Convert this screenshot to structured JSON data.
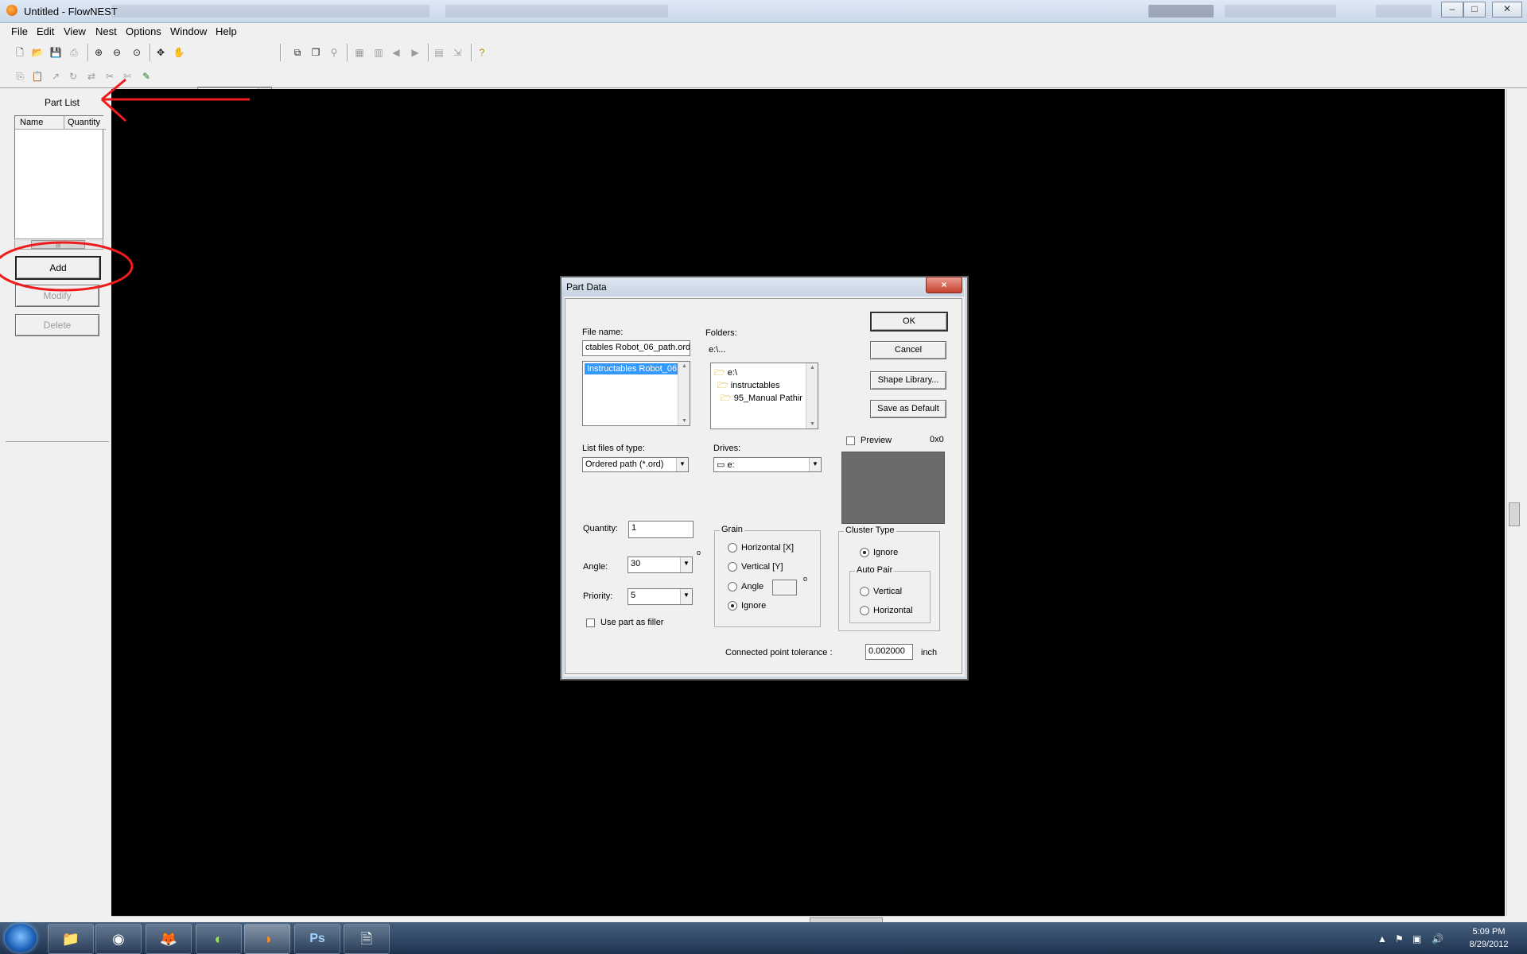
{
  "window": {
    "title": "Untitled - FlowNEST"
  },
  "menubar": [
    "File",
    "Edit",
    "View",
    "Nest",
    "Options",
    "Window",
    "Help"
  ],
  "toolbar": {
    "unit": "inch"
  },
  "part_list": {
    "title": "Part List",
    "columns": [
      "Name",
      "Quantity"
    ],
    "scroll_thumb": "|||",
    "buttons": {
      "add": "Add",
      "modify": "Modify",
      "delete": "Delete"
    }
  },
  "dialog": {
    "title": "Part Data",
    "close": "×",
    "file_name_label": "File name:",
    "file_name_value": "ctables Robot_06_path.ord",
    "file_list_selected": "Instructables Robot_06",
    "folders_label": "Folders:",
    "folders_path": "e:\\...",
    "folders": [
      "e:\\",
      "instructables",
      "95_Manual Pathir"
    ],
    "list_type_label": "List files of type:",
    "list_type_value": "Ordered path (*.ord)",
    "drives_label": "Drives:",
    "drives_value": "e:",
    "preview_label": "Preview",
    "preview_size": "0x0",
    "buttons": {
      "ok": "OK",
      "cancel": "Cancel",
      "shape_library": "Shape Library...",
      "save_default": "Save as Default"
    },
    "quantity_label": "Quantity:",
    "quantity_value": "1",
    "angle_label": "Angle:",
    "angle_value": "30",
    "degree_mark": "o",
    "priority_label": "Priority:",
    "priority_value": "5",
    "use_filler_label": "Use part as filler",
    "grain": {
      "title": "Grain",
      "options": [
        "Horizontal [X]",
        "Vertical [Y]",
        "Angle",
        "Ignore"
      ],
      "selected": "Ignore",
      "degree_mark": "o"
    },
    "cluster": {
      "title": "Cluster Type",
      "ignore_label": "Ignore",
      "selected": "Ignore",
      "auto_pair_title": "Auto Pair",
      "auto_pair_options": [
        "Vertical",
        "Horizontal"
      ]
    },
    "tolerance_label": "Connected point tolerance :",
    "tolerance_value": "0.002000",
    "tolerance_unit": "inch"
  },
  "taskbar": {
    "time": "5:09 PM",
    "date": "8/29/2012",
    "apps": [
      "file-explorer-icon",
      "chrome-icon",
      "firefox-icon",
      "app-green-icon",
      "flownest-icon",
      "photoshop-icon",
      "document-icon"
    ],
    "ps_label": "Ps"
  },
  "annotation_colors": {
    "arrow": "#ee1c1c",
    "circle": "#ee1c1c"
  }
}
